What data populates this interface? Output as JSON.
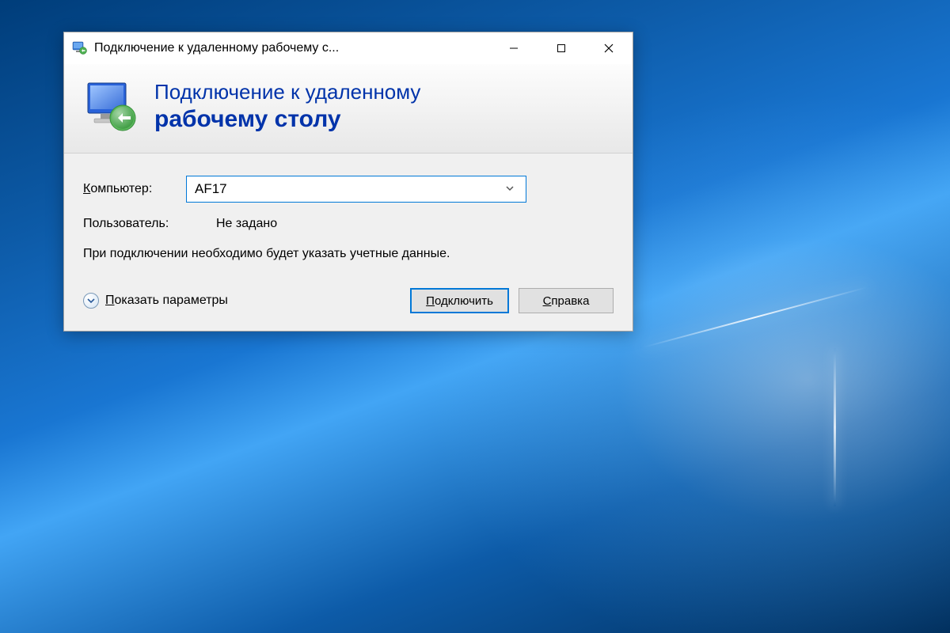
{
  "titlebar": {
    "title": "Подключение к удаленному рабочему с...",
    "icon_name": "rdp-icon"
  },
  "banner": {
    "line1": "Подключение к удаленному",
    "line2": "рабочему столу"
  },
  "form": {
    "computer_label": "Компьютер:",
    "computer_label_hotkey": "К",
    "computer_value": "AF17",
    "user_label": "Пользователь:",
    "user_value": "Не задано",
    "hint": "При подключении необходимо будет указать учетные данные."
  },
  "footer": {
    "show_options": "Показать параметры",
    "show_options_hotkey": "П",
    "connect": "Подключить",
    "connect_hotkey": "П",
    "help": "Справка",
    "help_hotkey": "С"
  }
}
